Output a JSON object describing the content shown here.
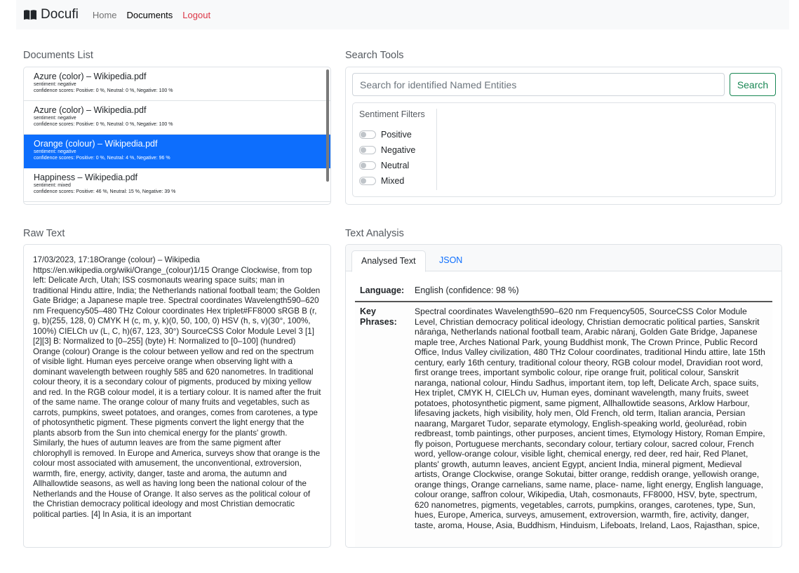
{
  "navbar": {
    "brand": "Docufi",
    "links": [
      "Home",
      "Documents",
      "Logout"
    ]
  },
  "documents": {
    "title": "Documents List",
    "items": [
      {
        "name": "Azure (color) – Wikipedia.pdf",
        "sentiment": "sentiment: negative",
        "scores": "confidence scores: Positive: 0 %, Neutral: 0 %, Negative: 100 %"
      },
      {
        "name": "Azure (color) – Wikipedia.pdf",
        "sentiment": "sentiment: negative",
        "scores": "confidence scores: Positive: 0 %, Neutral: 0 %, Negative: 100 %"
      },
      {
        "name": "Orange (colour) – Wikipedia.pdf",
        "sentiment": "sentiment: negative",
        "scores": "confidence scores: Positive: 0 %, Neutral: 4 %, Negative: 96 %",
        "selected": true
      },
      {
        "name": "Happiness – Wikipedia.pdf",
        "sentiment": "sentiment: mixed",
        "scores": "confidence scores: Positive: 46 %, Neutral: 15 %, Negative: 39 %"
      }
    ]
  },
  "search": {
    "title": "Search Tools",
    "placeholder": "Search for identified Named Entities",
    "button": "Search",
    "filters_title": "Sentiment Filters",
    "filters": [
      "Positive",
      "Negative",
      "Neutral",
      "Mixed"
    ]
  },
  "raw": {
    "title": "Raw Text",
    "text": "17/03/2023, 17:18Orange (colour) – Wikipedia https://en.wikipedia.org/wiki/Orange_(colour)1/15 Orange Clockwise, from top left: Delicate Arch, Utah; ISS cosmonauts wearing space suits; man in traditional Hindu attire, India; the Netherlands national football team; the Golden Gate Bridge; a Japanese maple tree. Spectral coordinates Wavelength590–620 nm Frequency505–480 THz Colour coordinates Hex triplet#FF8000 sRGB B (r, g, b)(255, 128, 0) CMYK H (c, m, y, k)(0, 50, 100, 0) HSV (h, s, v)(30°, 100%, 100%) CIELCh uv (L, C, h)(67, 123, 30°) SourceCSS Color Module Level 3 [1][2][3] B: Normalized to [0–255] (byte) H: Normalized to [0–100] (hundred) Orange (colour) Orange is the colour between yellow and red on the spectrum of visible light. Human eyes perceive orange when observing light with a dominant wavelength between roughly 585 and 620 nanometres. In traditional colour theory, it is a secondary colour of pigments, produced by mixing yellow and red. In the RGB colour model, it is a tertiary colour. It is named after the fruit of the same name. The orange colour of many fruits and vegetables, such as carrots, pumpkins, sweet potatoes, and oranges, comes from carotenes, a type of photosynthetic pigment. These pigments convert the light energy that the plants absorb from the Sun into chemical energy for the plants' growth. Similarly, the hues of autumn leaves are from the same pigment after chlorophyll is removed. In Europe and America, surveys show that orange is the colour most associated with amusement, the unconventional, extroversion, warmth, fire, energy, activity, danger, taste and aroma, the autumn and Allhallowtide seasons, as well as having long been the national colour of the Netherlands and the House of Orange. It also serves as the political colour of the Christian democracy political ideology and most Christian democratic political parties. [4] In Asia, it is an important"
  },
  "analysis": {
    "title": "Text Analysis",
    "tabs": [
      "Analysed Text",
      "JSON"
    ],
    "language_label": "Language:",
    "language_value": "English (confidence: 98 %)",
    "key_phrases_label": "Key Phrases:",
    "key_phrases": "Spectral coordinates Wavelength590–620 nm Frequency505, SourceCSS Color Module Level, Christian democracy political ideology, Christian democratic political parties, Sanskrit nāraṅga, Netherlands national football team, Arabic nāranj, Golden Gate Bridge, Japanese maple tree, Arches National Park, young Buddhist monk, The Crown Prince, Public Record Office, Indus Valley civilization, 480 THz Colour coordinates, traditional Hindu attire, late 15th century, early 16th century, traditional colour theory, RGB colour model, Dravidian root word, first orange trees, important symbolic colour, ripe orange fruit, political colour, Sanskrit naranga, national colour, Hindu Sadhus, important item, top left, Delicate Arch, space suits, Hex triplet, CMYK H, CIELCh uv, Human eyes, dominant wavelength, many fruits, sweet potatoes, photosynthetic pigment, same pigment, Allhallowtide seasons, Arklow Harbour, lifesaving jackets, high visibility, holy men, Old French, old term, Italian arancia, Persian naarang, Margaret Tudor, separate etymology, English-speaking world, ġeolurēad, robin redbreast, tomb paintings, other purposes, ancient times, Etymology History, Roman Empire, fly poison, Portuguese merchants, secondary colour, tertiary colour, sacred colour, French word, yellow-orange colour, visible light, chemical energy, red deer, red hair, Red Planet, plants' growth, autumn leaves, ancient Egypt, ancient India, mineral pigment, Medieval artists, Orange Clockwise, orange Sokutai, bitter orange, reddish orange, yellowish orange, orange things, Orange carnelians, same name, place- name, light energy, English language, colour orange, saffron colour, Wikipedia, Utah, cosmonauts, FF8000, HSV, byte, spectrum, 620 nanometres, pigments, vegetables, carrots, pumpkins, oranges, carotenes, type, Sun, hues, Europe, America, surveys, amusement, extroversion, warmth, fire, activity, danger, taste, aroma, House, Asia, Buddhism, Hinduism, Lifeboats, Ireland, Laos, Rajasthan, spice,"
  },
  "colors": {
    "primary": "#0d6efd",
    "success": "#198754",
    "danger": "#dc3545"
  }
}
